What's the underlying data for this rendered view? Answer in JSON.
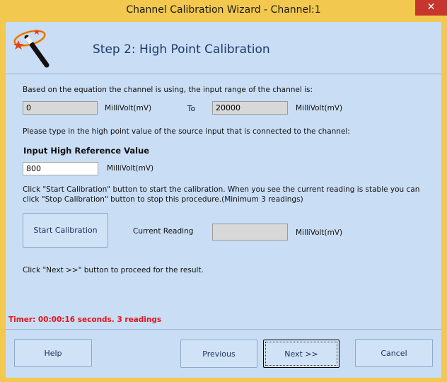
{
  "window": {
    "title": "Channel Calibration Wizard - Channel:1",
    "close_glyph": "✕"
  },
  "header": {
    "step_title": "Step 2: High Point Calibration",
    "logo_icon": "magic-wand-icon"
  },
  "range": {
    "intro": "Based on the equation the channel is using, the input range of the channel is:",
    "min_value": "0",
    "min_unit": "MilliVolt(mV)",
    "to_label": "To",
    "max_value": "20000",
    "max_unit": "MilliVolt(mV)"
  },
  "reference": {
    "prompt": "Please type in the high point value of the source input that is connected to the channel:",
    "label": "Input High Reference Value",
    "value": "800",
    "unit": "MilliVolt(mV)"
  },
  "calibration": {
    "instructions_line1": "Click \"Start Calibration\" button to start the calibration.  When you see the current reading is stable you can",
    "instructions_line2": "click \"Stop Calibration\" button to stop this procedure.(Minimum 3 readings)",
    "start_button": "Start Calibration",
    "current_reading_label": "Current Reading",
    "current_reading_value": "",
    "unit": "MilliVolt(mV)"
  },
  "next_hint": "Click \"Next >>\" button to proceed for the result.",
  "timer": "Timer: 00:00:16 seconds. 3 readings",
  "footer": {
    "help": "Help",
    "previous": "Previous",
    "next": "Next >>",
    "cancel": "Cancel"
  },
  "colors": {
    "title_bar": "#f2c84e",
    "client_bg": "#c9ddf4",
    "timer_text": "#e3141c",
    "close_button": "#c7362e"
  }
}
